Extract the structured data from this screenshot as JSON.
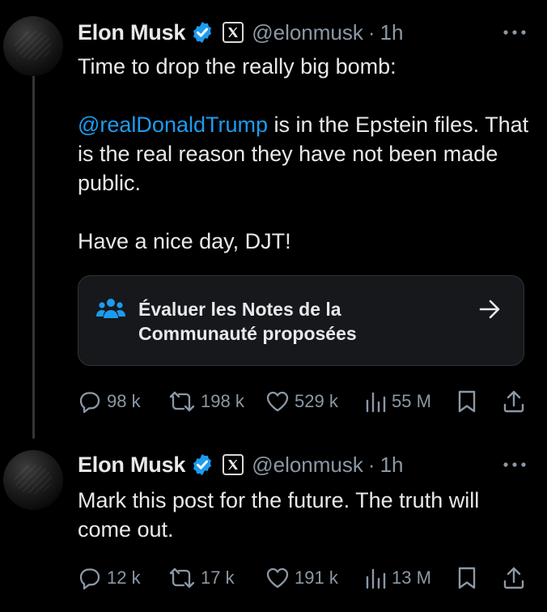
{
  "colors": {
    "background": "#000000",
    "text": "#e7e9ea",
    "secondary": "#8b98a5",
    "accent": "#1d9bf0",
    "border": "#2f3336"
  },
  "tweets": [
    {
      "author_name": "Elon Musk",
      "handle": "@elonmusk",
      "separator": "·",
      "time": "1h",
      "paragraphs": [
        "Time to drop the really big bomb:"
      ],
      "mention": "@realDonaldTrump",
      "mention_rest": " is in the Epstein files. That is the real reason they have not been made public.",
      "closing": "Have a nice day, DJT!",
      "community_note": {
        "line1": "Évaluer les Notes de la",
        "line2": "Communauté proposées",
        "icon": "people-icon",
        "arrow_icon": "arrow-right-icon"
      },
      "replies": "98 k",
      "reposts": "198 k",
      "likes": "529 k",
      "views": "55 M"
    },
    {
      "author_name": "Elon Musk",
      "handle": "@elonmusk",
      "separator": "·",
      "time": "1h",
      "text": "Mark this post for the future. The truth will come out.",
      "replies": "12 k",
      "reposts": "17 k",
      "likes": "191 k",
      "views": "13 M"
    }
  ]
}
